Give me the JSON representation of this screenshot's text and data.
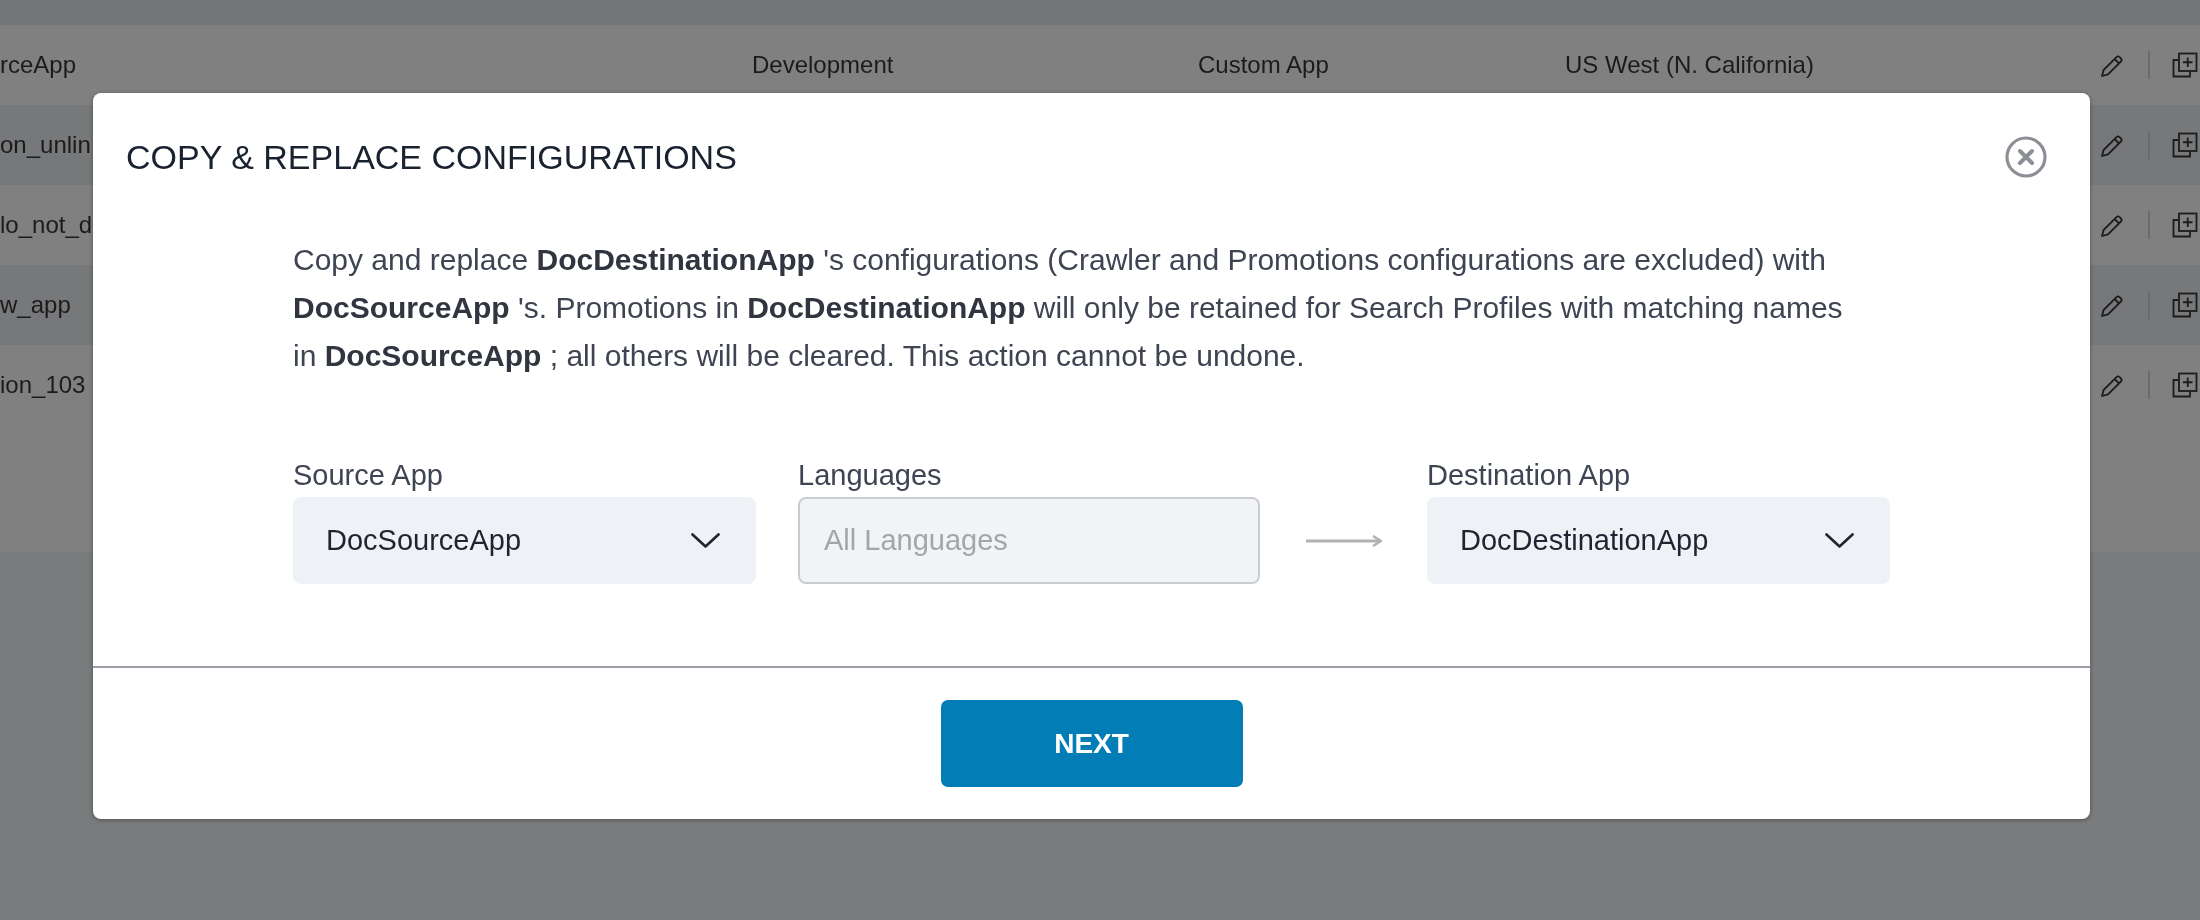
{
  "table": {
    "rows": [
      {
        "column_1": "rceApp",
        "column_2": "Development",
        "column_3": "Custom App",
        "column_4": "US West (N. California)"
      },
      {
        "column_1": "on_unlin"
      },
      {
        "column_1": "lo_not_d"
      },
      {
        "column_1": "w_app"
      },
      {
        "column_1": "ion_103"
      }
    ]
  },
  "dialog": {
    "title": "COPY & REPLACE CONFIGURATIONS",
    "message": "Copy and replace **DocDestinationApp** 's configurations (Crawler and Promotions configurations are excluded) with **DocSourceApp** 's. Promotions in **DocDestinationApp** will only be retained for Search Profiles with matching names in **DocSourceApp** ; all others will be cleared. This action cannot be undone.",
    "fields": [
      {
        "kind": "dropdown",
        "label": "Source App",
        "value": "DocSourceApp",
        "disabled": false
      },
      {
        "kind": "text",
        "label": "Languages",
        "value": "All Languages",
        "disabled": true
      },
      {
        "kind": "dropdown",
        "label": "Destination App",
        "value": "DocDestinationApp",
        "disabled": false
      }
    ],
    "next_button": "NEXT"
  }
}
